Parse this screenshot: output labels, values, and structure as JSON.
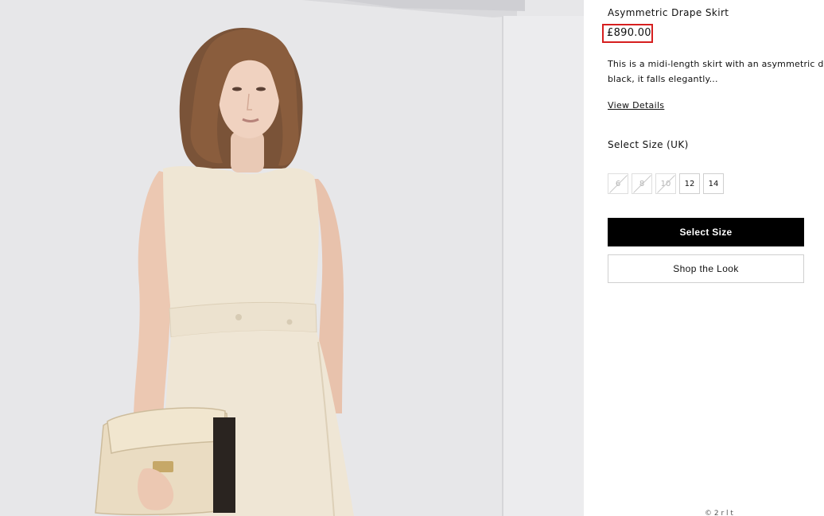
{
  "product": {
    "title": "Asymmetric Drape Skirt",
    "price": "£890.00",
    "description_lines": [
      "This is a midi-length skirt with an asymmetric draped",
      "black, it falls elegantly..."
    ],
    "details_link": "View Details",
    "size_label": "Select Size (UK)",
    "sizes": [
      {
        "label": "6",
        "available": false
      },
      {
        "label": "8",
        "available": false
      },
      {
        "label": "10",
        "available": false
      },
      {
        "label": "12",
        "available": true
      },
      {
        "label": "14",
        "available": true
      }
    ],
    "select_size_button": "Select Size",
    "shop_look_button": "Shop the Look",
    "footnote": "© 2   r   l   t"
  },
  "colors": {
    "highlight": "#d61f1f",
    "primary_button": "#000000",
    "background_image": "#e6e6e8",
    "dress": "#efe6d4",
    "bag": "#eadcc2"
  },
  "image": {
    "semantic": "model-wearing-cream-sleeveless-dress-with-clutch"
  }
}
